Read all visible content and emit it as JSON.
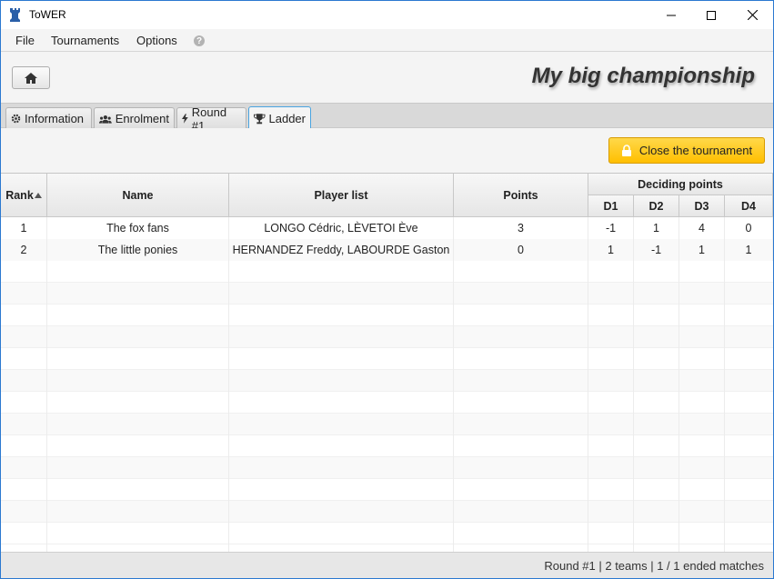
{
  "window": {
    "title": "ToWER"
  },
  "menu": {
    "items": [
      "File",
      "Tournaments",
      "Options"
    ]
  },
  "header": {
    "title": "My big championship"
  },
  "tabs": [
    {
      "label": "Information",
      "icon": "gear-icon"
    },
    {
      "label": "Enrolment",
      "icon": "users-icon"
    },
    {
      "label": "Round #1",
      "icon": "bolt-icon"
    },
    {
      "label": "Ladder",
      "icon": "trophy-icon",
      "active": true
    }
  ],
  "actions": {
    "close_tournament": "Close the tournament"
  },
  "table": {
    "headers": {
      "rank": "Rank",
      "name": "Name",
      "players": "Player list",
      "points": "Points",
      "deciding": "Deciding points",
      "d1": "D1",
      "d2": "D2",
      "d3": "D3",
      "d4": "D4"
    },
    "rows": [
      {
        "rank": "1",
        "name": "The fox fans",
        "players": "LONGO Cédric, LÈVETOI Ève",
        "points": "3",
        "d1": "-1",
        "d2": "1",
        "d3": "4",
        "d4": "0"
      },
      {
        "rank": "2",
        "name": "The little ponies",
        "players": "HERNANDEZ Freddy, LABOURDE Gaston",
        "points": "0",
        "d1": "1",
        "d2": "-1",
        "d3": "1",
        "d4": "1"
      }
    ]
  },
  "status": {
    "text": "Round #1 | 2 teams | 1 / 1 ended matches"
  },
  "colors": {
    "accent": "#ffc600",
    "tab_active_border": "#4aa4e0"
  }
}
